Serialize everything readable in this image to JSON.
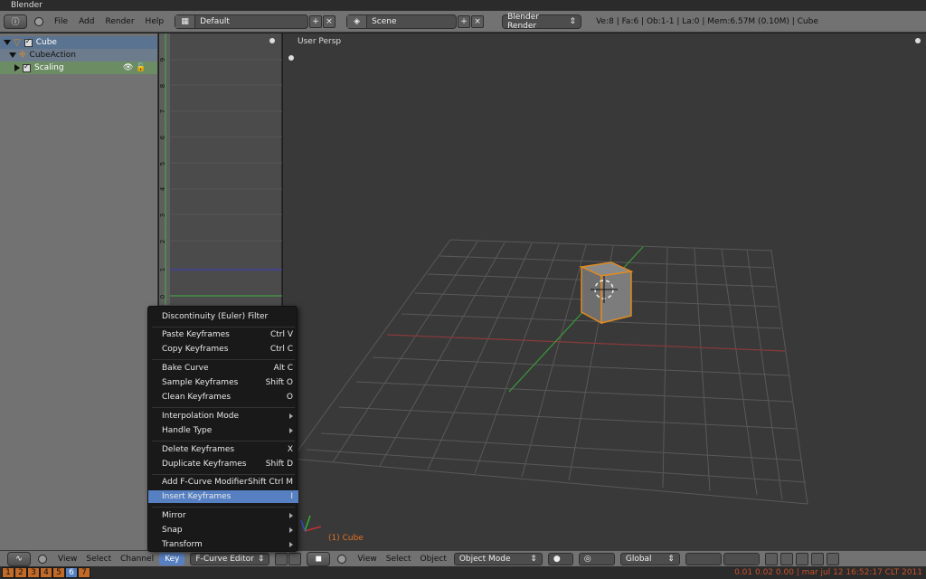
{
  "title": "Blender",
  "infobar": {
    "menus": [
      "File",
      "Add",
      "Render",
      "Help"
    ],
    "screen_layout": "Default",
    "scene": "Scene",
    "render_engine": "Blender Render",
    "stats": "Ve:8 | Fa:6 | Ob:1-1 | La:0 | Mem:6.57M (0.10M) | Cube"
  },
  "outliner": {
    "items": [
      {
        "label": "Cube"
      },
      {
        "label": "CubeAction"
      },
      {
        "label": "Scaling"
      }
    ]
  },
  "graph_ruler": [
    "0",
    "1",
    "2",
    "3",
    "4",
    "5",
    "6",
    "7",
    "8",
    "9"
  ],
  "viewport": {
    "label": "User Persp",
    "object_label": "(1) Cube"
  },
  "popup_menu": {
    "items": [
      {
        "label": "Discontinuity (Euler) Filter",
        "shortcut": ""
      },
      {
        "label": "Paste Keyframes",
        "shortcut": "Ctrl V"
      },
      {
        "label": "Copy Keyframes",
        "shortcut": "Ctrl C"
      },
      {
        "label": "Bake Curve",
        "shortcut": "Alt C"
      },
      {
        "label": "Sample Keyframes",
        "shortcut": "Shift O"
      },
      {
        "label": "Clean Keyframes",
        "shortcut": "O"
      },
      {
        "label": "Interpolation Mode",
        "shortcut": ""
      },
      {
        "label": "Handle Type",
        "shortcut": ""
      },
      {
        "label": "Delete Keyframes",
        "shortcut": "X"
      },
      {
        "label": "Duplicate Keyframes",
        "shortcut": "Shift D"
      },
      {
        "label": "Add F-Curve Modifier",
        "shortcut": "Shift Ctrl M"
      },
      {
        "label": "Insert Keyframes",
        "shortcut": "I"
      },
      {
        "label": "Mirror",
        "shortcut": ""
      },
      {
        "label": "Snap",
        "shortcut": ""
      },
      {
        "label": "Transform",
        "shortcut": ""
      }
    ]
  },
  "bottombar": {
    "graph_menus": [
      "View",
      "Select",
      "Channel",
      "Key"
    ],
    "graph_mode": "F-Curve Editor",
    "view3d_menus": [
      "View",
      "Select",
      "Object"
    ],
    "object_mode": "Object Mode",
    "transform_orientation": "Global"
  },
  "statusbar": {
    "layers": [
      "1",
      "2",
      "3",
      "4",
      "5",
      "6",
      "7"
    ],
    "text": "0.01  0.02  0.00  |  mar  jul 12 16:52:17 CLT 2011"
  },
  "colors": {
    "highlight": "#5680c2",
    "selected_orange": "#e08a20",
    "grid": "#595959"
  }
}
